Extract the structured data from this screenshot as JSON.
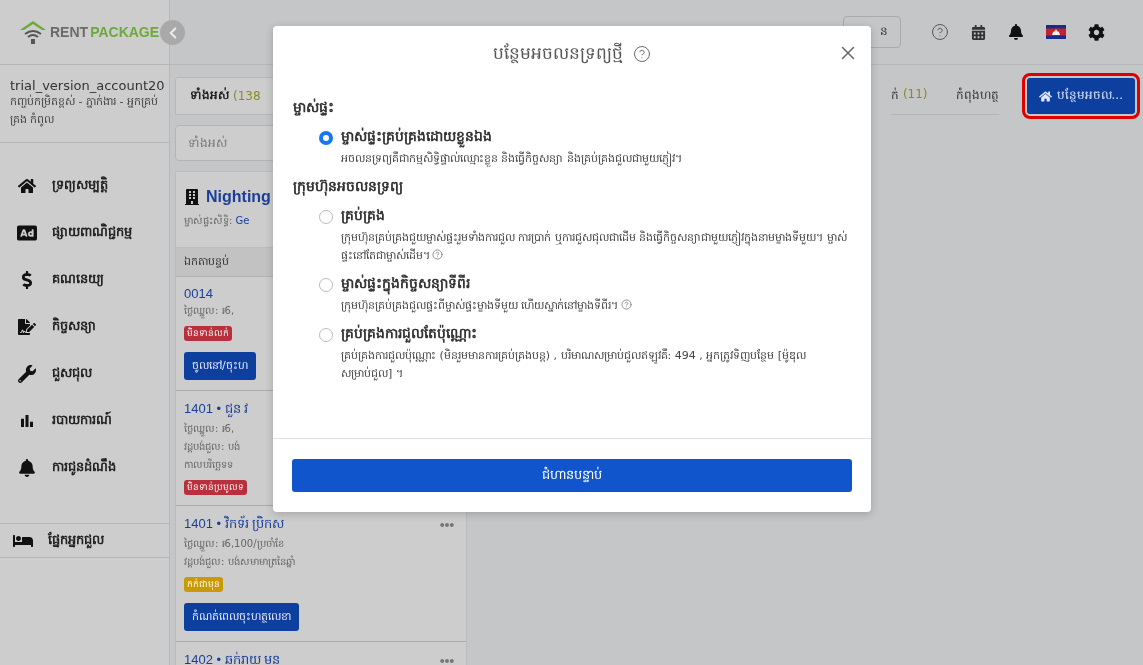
{
  "sidebar": {
    "logo": {
      "word_1": "RENT",
      "word_2": "PACKAGE"
    },
    "account": {
      "name": "trial_version_account20",
      "role": "កញ្ចប់កម្រិតខ្ពស់ - ភ្នាក់ងារ - អ្នកគ្រប់គ្រង កំពូល"
    },
    "nav_items": [
      {
        "label": "ទ្រព្យសម្បត្តិ"
      },
      {
        "label": "ផ្សាយពាណិជ្ជកម្ម"
      },
      {
        "label": "គណនេយ្យ"
      },
      {
        "label": "កិច្ចសន្យា"
      },
      {
        "label": "ជួសជុល"
      },
      {
        "label": "របាយការណ៍"
      },
      {
        "label": "ការជូនដំណឹង"
      }
    ],
    "tenant_item": {
      "label": "ផ្នែកអ្នកជួល"
    }
  },
  "header": {
    "language_box": "ន"
  },
  "list_panel": {
    "tab": {
      "label": "ទាំងអស់",
      "count": "(138"
    },
    "search": {
      "placeholder": "ទាំងអស់"
    },
    "property": {
      "name": "Nighting",
      "owner_label": "ម្ចាស់ផ្ទះសិទ្ធិ:",
      "owner_value": "Ge"
    },
    "units_heading": "ឯកតាបន្ទប់",
    "units": [
      {
        "title": "0014",
        "lines": [
          "ថ្លៃឈ្នួល: ៛6,"
        ],
        "badge": {
          "label": "មិនទាន់លក់",
          "color": "#b8303d"
        },
        "button": "ចូលនៅ/ចុះហ"
      },
      {
        "title": "1401 • ជួន វ",
        "lines": [
          "ថ្លៃឈ្នួល: ៛6,",
          "វដ្តបង់ជួល: បង់",
          "កាលបរិច្ឆេទទ"
        ],
        "badge": {
          "label": "មិនទាន់ប្រមូលទ",
          "color": "#b8303d"
        }
      },
      {
        "title": "1401 • វិកទ័រ ប្រិកស",
        "lines": [
          "ថ្លៃឈ្នួល: ៛6,100/ប្រចាំខែ",
          "វដ្តបង់ជួល: បង់សមាមាត្រនៃឆ្នាំ"
        ],
        "badge": {
          "label": "កក់ជាមុន",
          "color": "#c99a06"
        },
        "button": "កំណត់ពេលចុះហត្ថលេខា",
        "more": true
      },
      {
        "title": "1402 • ឆក់រាយ មន",
        "more": true
      }
    ]
  },
  "status_tabs": [
    {
      "label": "ក់",
      "count": "(11)"
    },
    {
      "label": "កំពុងហត្ថ"
    }
  ],
  "add_button": {
    "label": "បន្ថែមអចល...",
    "highlighted": true
  },
  "modal": {
    "title": "បន្ថែមអចលនទ្រព្យថ្មី",
    "sections": [
      {
        "heading": "ម្ចាស់ផ្ទះ",
        "options": [
          {
            "label": "ម្ចាស់ផ្ទះគ្រប់គ្រងដោយខ្លួនឯង",
            "description": "អចលនទ្រព្យគឺជាកម្មសិទ្ធិផ្ទាល់ឈ្មោះខ្លួន និងធ្វើកិច្ចសន្យា និងគ្រប់គ្រងជួលជាមួយភ្ញៀវ។",
            "selected": true,
            "help": false
          }
        ]
      },
      {
        "heading": "ក្រុមហ៊ុនអចលនទ្រព្យ",
        "options": [
          {
            "label": "គ្រប់គ្រង",
            "description": "ក្រុមហ៊ុនគ្រប់គ្រងជួយម្ចាស់ផ្ទះរួមទាំងការជួល ការប្រាក់ ឬការជួសជុលជាដើម និងធ្វើកិច្ចសន្យាជាមួយភ្ញៀវក្នុងនាមម្ខាងទីមួយ។ ម្ចាស់ផ្ទះនៅតែជាម្ចាស់ដើម។",
            "selected": false,
            "help": true
          },
          {
            "label": "ម្ចាស់ផ្ទះក្នុងកិច្ចសន្យាទីពីរ",
            "description": "ក្រុមហ៊ុនគ្រប់គ្រងជួលផ្ទះពីម្ចាស់ផ្ទះម្ខាងទីមួយ ហើយស្នាក់នៅម្ខាងទីពីរ។",
            "selected": false,
            "help": true
          },
          {
            "label": "គ្រប់គ្រងការជួលតែប៉ុណ្ណោះ",
            "description": "គ្រប់គ្រងការជួលប៉ុណ្ណោះ (មិនរួមមានការគ្រប់គ្រងបន្ត) , បរិមាណសម្រាប់ជួលឥឡូវគឺ: 494 , អ្នកត្រូវទិញបន្ថែម  [ម៉ូឌុលសម្រាប់ជួល] ។",
            "selected": false,
            "help": false
          }
        ]
      }
    ],
    "next_button": "ជំហានបន្ទាប់"
  }
}
